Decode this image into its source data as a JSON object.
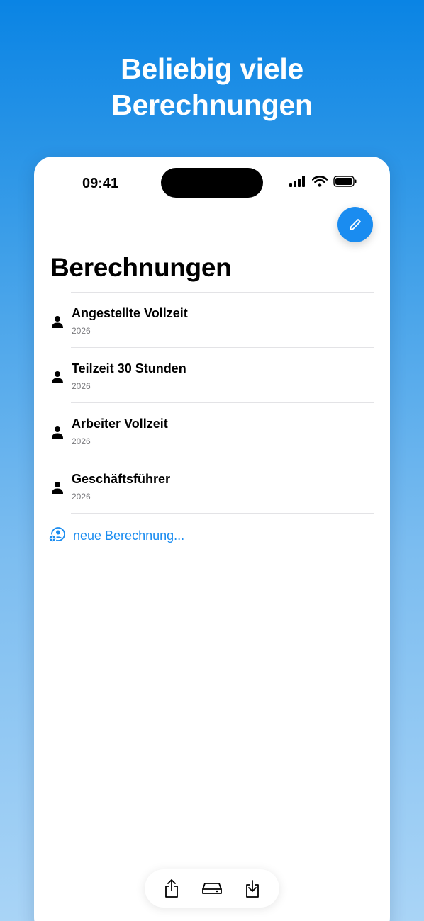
{
  "headline": {
    "line1": "Beliebig viele",
    "line2": "Berechnungen"
  },
  "status_bar": {
    "time": "09:41"
  },
  "page": {
    "title": "Berechnungen"
  },
  "calculations": [
    {
      "name": "Angestellte Vollzeit",
      "year": "2026",
      "icon": "person-icon"
    },
    {
      "name": "Teilzeit 30 Stunden",
      "year": "2026",
      "icon": "person-icon"
    },
    {
      "name": "Arbeiter Vollzeit",
      "year": "2026",
      "icon": "person-icon"
    },
    {
      "name": "Geschäftsführer",
      "year": "2026",
      "icon": "person-icon"
    }
  ],
  "add": {
    "label": "neue Berechnung...",
    "icon": "add-person-icon"
  },
  "toolbar": {
    "icons": [
      "share-icon",
      "storage-icon",
      "download-icon"
    ]
  },
  "colors": {
    "accent": "#1a8cf0",
    "background_top": "#0a84e4",
    "background_bottom": "#a9d4f6"
  }
}
